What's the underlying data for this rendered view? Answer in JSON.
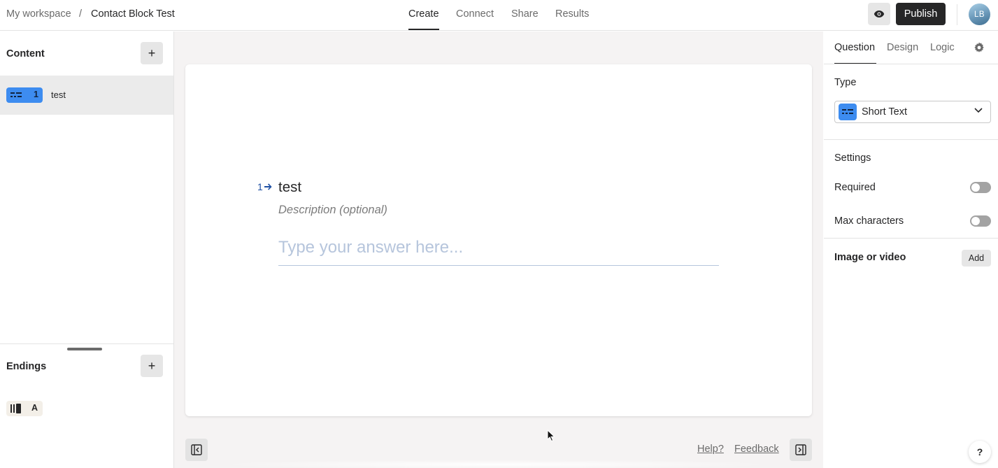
{
  "breadcrumb": {
    "workspace": "My workspace",
    "separator": "/",
    "form": "Contact Block Test"
  },
  "nav_tabs": [
    {
      "label": "Create",
      "active": true
    },
    {
      "label": "Connect",
      "active": false
    },
    {
      "label": "Share",
      "active": false
    },
    {
      "label": "Results",
      "active": false
    }
  ],
  "header": {
    "preview_icon": "eye-icon",
    "publish_label": "Publish",
    "avatar_initials": "LB"
  },
  "sidebar": {
    "content_title": "Content",
    "add_symbol": "+",
    "questions": [
      {
        "number": "1",
        "label": "test",
        "icon": "short-text-icon"
      }
    ],
    "endings_title": "Endings",
    "endings": [
      {
        "letter": "A",
        "icon": "ending-icon"
      }
    ]
  },
  "canvas": {
    "question_number": "1",
    "question_title": "test",
    "question_description": "Description (optional)",
    "answer_placeholder": "Type your answer here...",
    "help_link": "Help?",
    "feedback_link": "Feedback"
  },
  "panel": {
    "tabs": [
      {
        "label": "Question",
        "active": true
      },
      {
        "label": "Design",
        "active": false
      },
      {
        "label": "Logic",
        "active": false
      }
    ],
    "type_heading": "Type",
    "type_value": "Short Text",
    "settings_heading": "Settings",
    "required_label": "Required",
    "required_on": false,
    "max_chars_label": "Max characters",
    "max_chars_on": false,
    "media_label": "Image or video",
    "media_add_label": "Add",
    "help_symbol": "?"
  },
  "colors": {
    "accent": "#3d8cf0",
    "dark": "#262627",
    "canvas_bg": "#f5f3f3"
  }
}
